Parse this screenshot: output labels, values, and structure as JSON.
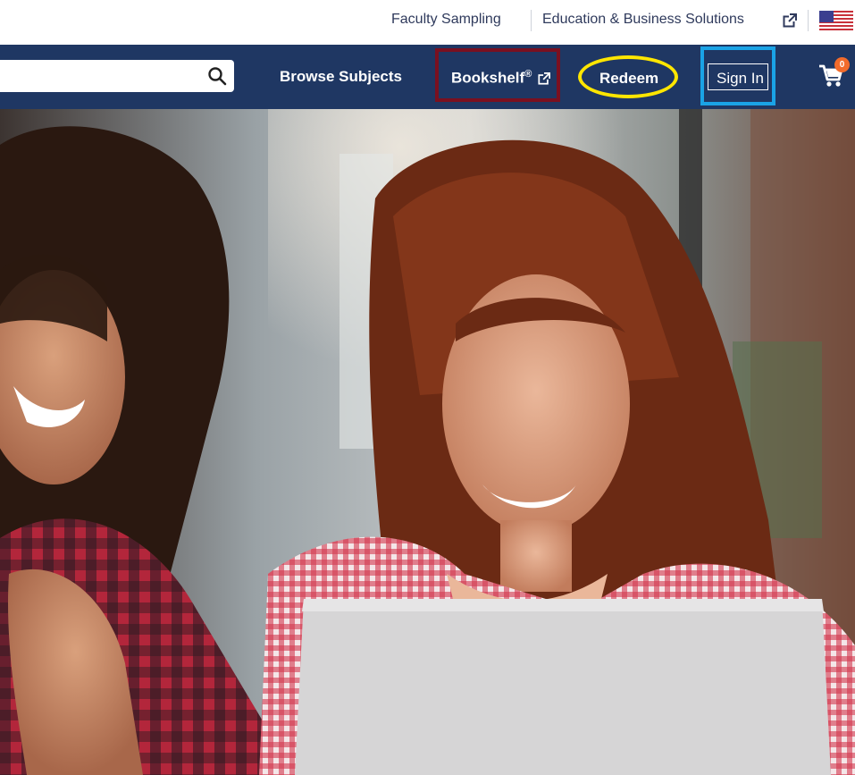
{
  "utility_bar": {
    "faculty_sampling": "Faculty Sampling",
    "education_business": "Education & Business Solutions",
    "external_icon": "external-link-icon",
    "flag_icon": "us-flag-icon"
  },
  "nav": {
    "search": {
      "placeholder": "",
      "value": "",
      "icon": "search-icon"
    },
    "browse_subjects": "Browse Subjects",
    "bookshelf": "Bookshelf",
    "bookshelf_mark": "®",
    "bookshelf_icon": "external-link-icon",
    "redeem": "Redeem",
    "sign_in": "Sign In",
    "cart": {
      "icon": "cart-icon",
      "count": "0"
    }
  },
  "highlights": {
    "bookshelf_box": "#7a1020",
    "redeem_ellipse": "#ffe600",
    "signin_box": "#1aa3e6"
  },
  "colors": {
    "nav_bg": "#1f3763",
    "badge": "#f26b2b"
  }
}
